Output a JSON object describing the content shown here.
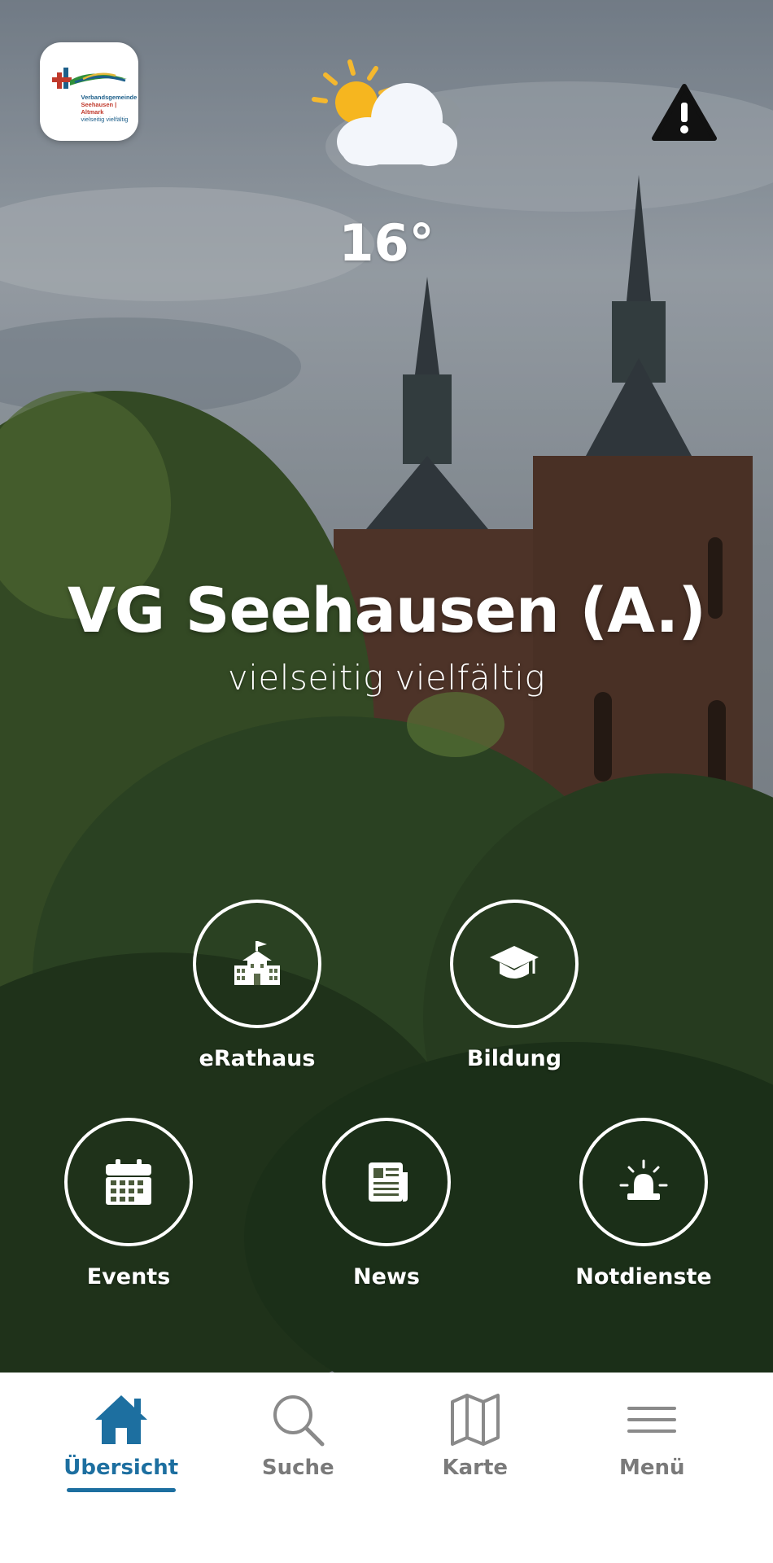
{
  "header": {
    "logo": {
      "icon": "verbandsgemeinde-logo",
      "lines": [
        "Verbandsgemeinde",
        "Seehausen | Altmark",
        "vielseitig vielfältig"
      ]
    },
    "weather": {
      "icon": "partly-cloudy-icon",
      "temperature": "16°"
    },
    "alert_icon": "warning-icon"
  },
  "hero": {
    "title": "VG Seehausen (A.)",
    "subtitle": "vielseitig vielfältig"
  },
  "tiles": [
    {
      "label": "eRathaus",
      "icon": "town-hall-icon"
    },
    {
      "label": "Bildung",
      "icon": "graduation-cap-icon"
    },
    {
      "label": "Events",
      "icon": "calendar-icon"
    },
    {
      "label": "News",
      "icon": "newspaper-icon"
    },
    {
      "label": "Notdienste",
      "icon": "siren-icon"
    }
  ],
  "tabbar": {
    "items": [
      {
        "label": "Übersicht",
        "icon": "home-icon",
        "active": true
      },
      {
        "label": "Suche",
        "icon": "search-icon",
        "active": false
      },
      {
        "label": "Karte",
        "icon": "map-icon",
        "active": false
      },
      {
        "label": "Menü",
        "icon": "menu-icon",
        "active": false
      }
    ]
  },
  "colors": {
    "accent": "#1d6fa0",
    "inactive": "#7a7a7a",
    "tile_ring": "#ffffff"
  }
}
